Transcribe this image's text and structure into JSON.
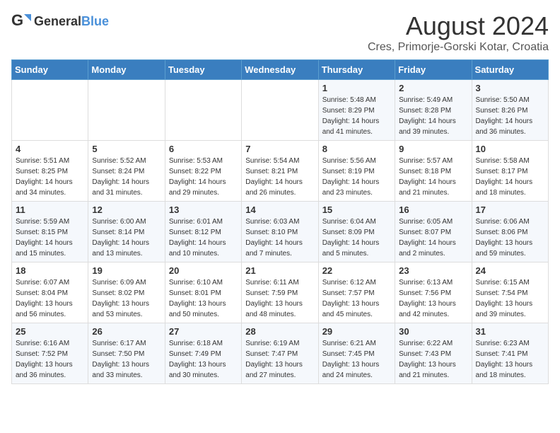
{
  "header": {
    "logo_general": "General",
    "logo_blue": "Blue",
    "title": "August 2024",
    "location": "Cres, Primorje-Gorski Kotar, Croatia"
  },
  "weekdays": [
    "Sunday",
    "Monday",
    "Tuesday",
    "Wednesday",
    "Thursday",
    "Friday",
    "Saturday"
  ],
  "weeks": [
    [
      {
        "day": "",
        "info": ""
      },
      {
        "day": "",
        "info": ""
      },
      {
        "day": "",
        "info": ""
      },
      {
        "day": "",
        "info": ""
      },
      {
        "day": "1",
        "info": "Sunrise: 5:48 AM\nSunset: 8:29 PM\nDaylight: 14 hours\nand 41 minutes."
      },
      {
        "day": "2",
        "info": "Sunrise: 5:49 AM\nSunset: 8:28 PM\nDaylight: 14 hours\nand 39 minutes."
      },
      {
        "day": "3",
        "info": "Sunrise: 5:50 AM\nSunset: 8:26 PM\nDaylight: 14 hours\nand 36 minutes."
      }
    ],
    [
      {
        "day": "4",
        "info": "Sunrise: 5:51 AM\nSunset: 8:25 PM\nDaylight: 14 hours\nand 34 minutes."
      },
      {
        "day": "5",
        "info": "Sunrise: 5:52 AM\nSunset: 8:24 PM\nDaylight: 14 hours\nand 31 minutes."
      },
      {
        "day": "6",
        "info": "Sunrise: 5:53 AM\nSunset: 8:22 PM\nDaylight: 14 hours\nand 29 minutes."
      },
      {
        "day": "7",
        "info": "Sunrise: 5:54 AM\nSunset: 8:21 PM\nDaylight: 14 hours\nand 26 minutes."
      },
      {
        "day": "8",
        "info": "Sunrise: 5:56 AM\nSunset: 8:19 PM\nDaylight: 14 hours\nand 23 minutes."
      },
      {
        "day": "9",
        "info": "Sunrise: 5:57 AM\nSunset: 8:18 PM\nDaylight: 14 hours\nand 21 minutes."
      },
      {
        "day": "10",
        "info": "Sunrise: 5:58 AM\nSunset: 8:17 PM\nDaylight: 14 hours\nand 18 minutes."
      }
    ],
    [
      {
        "day": "11",
        "info": "Sunrise: 5:59 AM\nSunset: 8:15 PM\nDaylight: 14 hours\nand 15 minutes."
      },
      {
        "day": "12",
        "info": "Sunrise: 6:00 AM\nSunset: 8:14 PM\nDaylight: 14 hours\nand 13 minutes."
      },
      {
        "day": "13",
        "info": "Sunrise: 6:01 AM\nSunset: 8:12 PM\nDaylight: 14 hours\nand 10 minutes."
      },
      {
        "day": "14",
        "info": "Sunrise: 6:03 AM\nSunset: 8:10 PM\nDaylight: 14 hours\nand 7 minutes."
      },
      {
        "day": "15",
        "info": "Sunrise: 6:04 AM\nSunset: 8:09 PM\nDaylight: 14 hours\nand 5 minutes."
      },
      {
        "day": "16",
        "info": "Sunrise: 6:05 AM\nSunset: 8:07 PM\nDaylight: 14 hours\nand 2 minutes."
      },
      {
        "day": "17",
        "info": "Sunrise: 6:06 AM\nSunset: 8:06 PM\nDaylight: 13 hours\nand 59 minutes."
      }
    ],
    [
      {
        "day": "18",
        "info": "Sunrise: 6:07 AM\nSunset: 8:04 PM\nDaylight: 13 hours\nand 56 minutes."
      },
      {
        "day": "19",
        "info": "Sunrise: 6:09 AM\nSunset: 8:02 PM\nDaylight: 13 hours\nand 53 minutes."
      },
      {
        "day": "20",
        "info": "Sunrise: 6:10 AM\nSunset: 8:01 PM\nDaylight: 13 hours\nand 50 minutes."
      },
      {
        "day": "21",
        "info": "Sunrise: 6:11 AM\nSunset: 7:59 PM\nDaylight: 13 hours\nand 48 minutes."
      },
      {
        "day": "22",
        "info": "Sunrise: 6:12 AM\nSunset: 7:57 PM\nDaylight: 13 hours\nand 45 minutes."
      },
      {
        "day": "23",
        "info": "Sunrise: 6:13 AM\nSunset: 7:56 PM\nDaylight: 13 hours\nand 42 minutes."
      },
      {
        "day": "24",
        "info": "Sunrise: 6:15 AM\nSunset: 7:54 PM\nDaylight: 13 hours\nand 39 minutes."
      }
    ],
    [
      {
        "day": "25",
        "info": "Sunrise: 6:16 AM\nSunset: 7:52 PM\nDaylight: 13 hours\nand 36 minutes."
      },
      {
        "day": "26",
        "info": "Sunrise: 6:17 AM\nSunset: 7:50 PM\nDaylight: 13 hours\nand 33 minutes."
      },
      {
        "day": "27",
        "info": "Sunrise: 6:18 AM\nSunset: 7:49 PM\nDaylight: 13 hours\nand 30 minutes."
      },
      {
        "day": "28",
        "info": "Sunrise: 6:19 AM\nSunset: 7:47 PM\nDaylight: 13 hours\nand 27 minutes."
      },
      {
        "day": "29",
        "info": "Sunrise: 6:21 AM\nSunset: 7:45 PM\nDaylight: 13 hours\nand 24 minutes."
      },
      {
        "day": "30",
        "info": "Sunrise: 6:22 AM\nSunset: 7:43 PM\nDaylight: 13 hours\nand 21 minutes."
      },
      {
        "day": "31",
        "info": "Sunrise: 6:23 AM\nSunset: 7:41 PM\nDaylight: 13 hours\nand 18 minutes."
      }
    ]
  ]
}
